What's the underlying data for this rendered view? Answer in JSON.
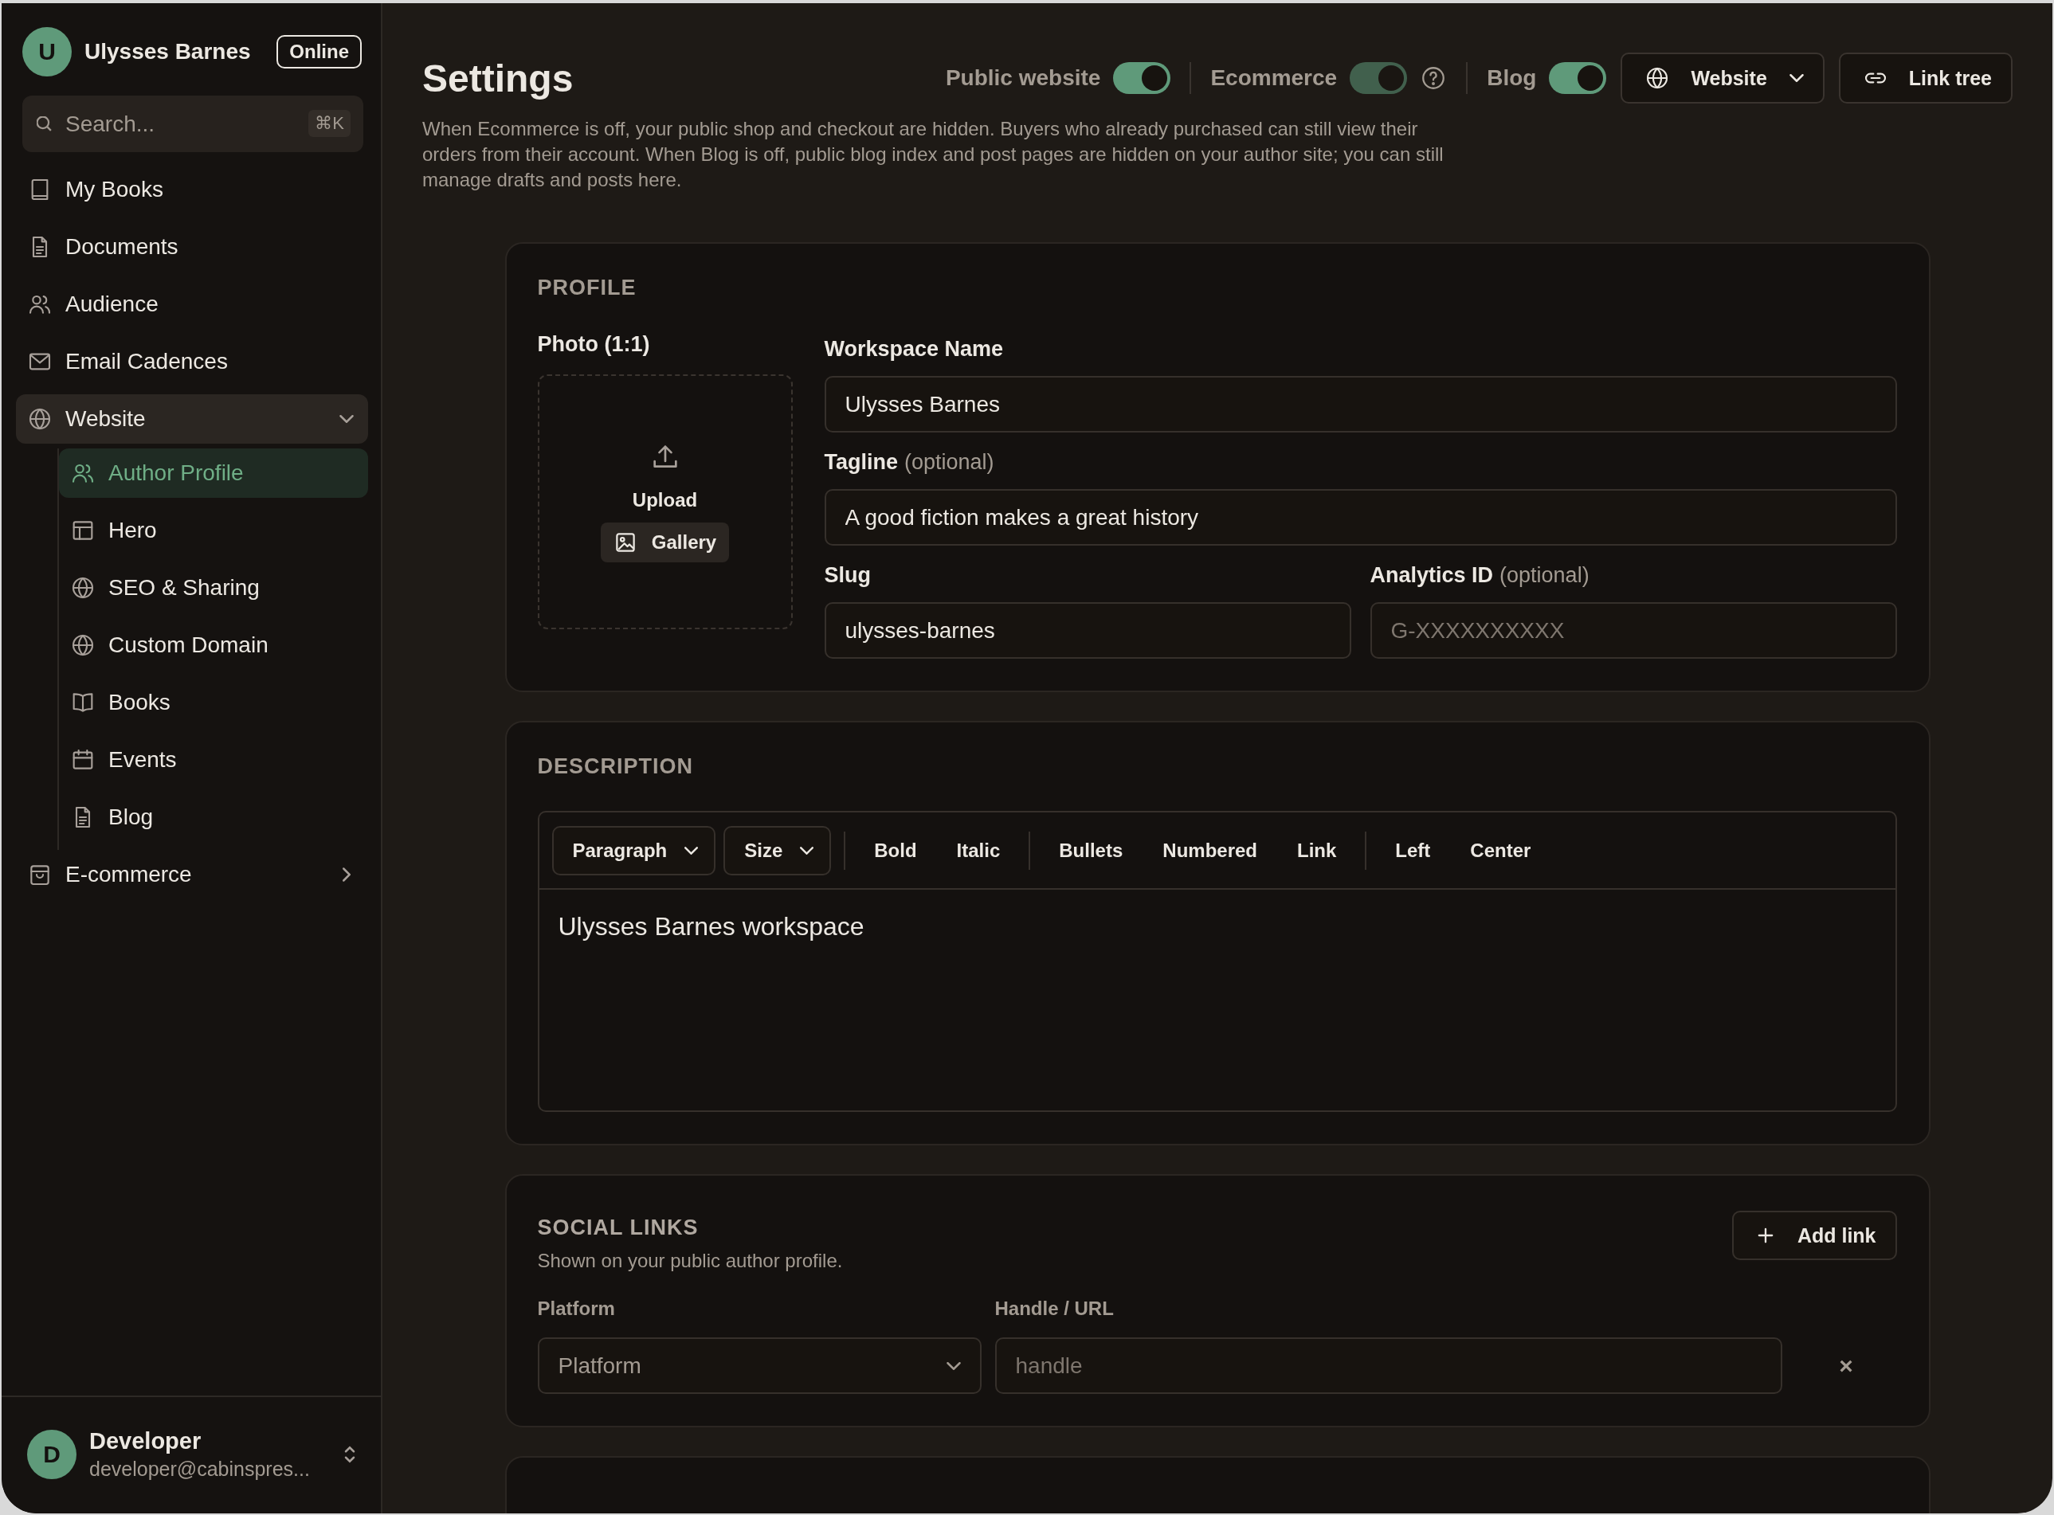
{
  "sidebar": {
    "user": {
      "initial": "U",
      "name": "Ulysses Barnes",
      "status": "Online"
    },
    "search": {
      "placeholder": "Search...",
      "shortcut": "⌘K"
    },
    "items": [
      {
        "kind": "link",
        "label": "My Books",
        "selected": false
      },
      {
        "kind": "link",
        "label": "Documents",
        "selected": false
      },
      {
        "kind": "link",
        "label": "Audience",
        "selected": false
      },
      {
        "kind": "link",
        "label": "Email Cadences",
        "selected": false
      },
      {
        "kind": "group",
        "label": "Website",
        "selected": false,
        "expanded": true,
        "children": [
          {
            "label": "Author Profile",
            "selected": true
          },
          {
            "label": "Hero",
            "selected": false
          },
          {
            "label": "SEO & Sharing",
            "selected": false
          },
          {
            "label": "Custom Domain",
            "selected": false
          },
          {
            "label": "Books",
            "selected": false
          },
          {
            "label": "Events",
            "selected": false
          },
          {
            "label": "Blog",
            "selected": false
          }
        ]
      },
      {
        "kind": "group",
        "label": "E-commerce",
        "selected": false,
        "expanded": false
      }
    ],
    "account": {
      "initial": "D",
      "name": "Developer",
      "email": "developer@cabinspres..."
    }
  },
  "header": {
    "title": "Settings",
    "toggles": [
      {
        "kind": "plain",
        "label": "Public website",
        "on": true,
        "disabled": false
      },
      {
        "kind": "with_help",
        "label": "Ecommerce",
        "on": true,
        "disabled": true
      },
      {
        "kind": "plain",
        "label": "Blog",
        "on": true,
        "disabled": false
      }
    ],
    "buttons": [
      {
        "label": "Website",
        "dropdown": true
      },
      {
        "label": "Link tree",
        "dropdown": false
      }
    ],
    "note": "When Ecommerce is off, your public shop and checkout are hidden. Buyers who already purchased can still view their orders from their account. When Blog is off, public blog index and post pages are hidden on your author site; you can still manage drafts and posts here."
  },
  "profile": {
    "heading": "PROFILE",
    "photo": {
      "label": "Photo (1:1)",
      "upload": "Upload",
      "gallery": "Gallery"
    },
    "fields": [
      {
        "label": "Workspace Name",
        "value": "Ulysses Barnes"
      },
      {
        "label": "Tagline",
        "hint": "(optional)",
        "value": "A good fiction makes a great history"
      },
      {
        "label": "Slug",
        "value": "ulysses-barnes"
      },
      {
        "label": "Analytics ID",
        "hint": "(optional)",
        "placeholder": "G-XXXXXXXXXX"
      }
    ]
  },
  "description": {
    "heading": "DESCRIPTION",
    "toolbar": [
      [
        {
          "kind": "dropdown",
          "label": "Paragraph"
        },
        {
          "kind": "dropdown",
          "label": "Size"
        }
      ],
      [
        {
          "kind": "button",
          "label": "Bold"
        },
        {
          "kind": "button",
          "label": "Italic"
        }
      ],
      [
        {
          "kind": "button",
          "label": "Bullets"
        },
        {
          "kind": "button",
          "label": "Numbered"
        },
        {
          "kind": "button",
          "label": "Link"
        }
      ],
      [
        {
          "kind": "button",
          "label": "Left"
        },
        {
          "kind": "button",
          "label": "Center"
        }
      ]
    ],
    "text": "Ulysses Barnes workspace"
  },
  "social_links": {
    "heading": "SOCIAL LINKS",
    "subtitle": "Shown on your public author profile.",
    "add_button": "Add link",
    "columns": [
      "Platform",
      "Handle / URL"
    ],
    "rows": [
      {
        "platform_placeholder": "Platform",
        "handle_placeholder": "handle",
        "remove": "×"
      }
    ]
  }
}
